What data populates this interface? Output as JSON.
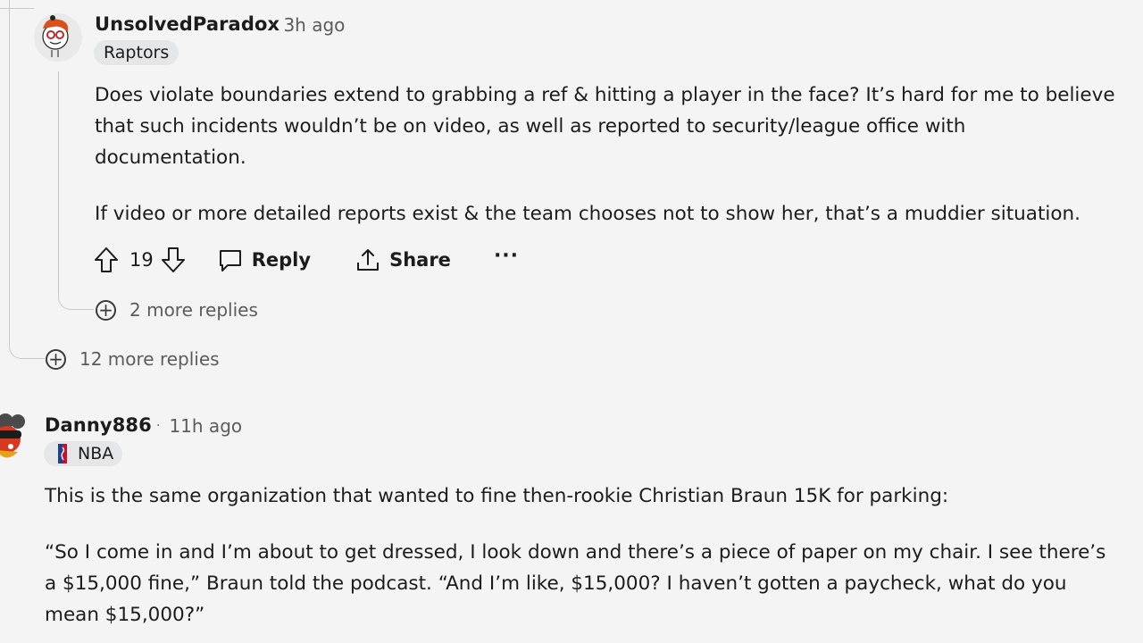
{
  "comment1": {
    "username": "UnsolvedParadox",
    "separator": "·",
    "time": "3h ago",
    "flair": "Raptors",
    "paragraphs": [
      "Does violate boundaries extend to grabbing a ref & hitting a player in the face? It’s hard for me to believe",
      "that such incidents wouldn’t be on video, as well as reported to security/league office with",
      "documentation.",
      "If video or more detailed reports exist & the team chooses not to show her, that’s a muddier situation."
    ],
    "votes": "19",
    "reply_label": "Reply",
    "share_label": "Share",
    "more_label": "···",
    "more_replies": "2 more replies"
  },
  "parent_more_replies": "12 more replies",
  "comment2": {
    "username": "Danny886",
    "separator": "·",
    "time": "11h ago",
    "flair": "NBA",
    "paragraphs": [
      "This is the same organization that wanted to fine then-rookie Christian Braun 15K for parking:",
      "“So I come in and I’m about to get dressed, I look down and there’s a piece of paper on my chair. I see there’s",
      "a $15,000 fine,” Braun told the podcast. “And I’m like, $15,000? I haven’t gotten a paycheck, what do you",
      "mean $15,000?”"
    ]
  },
  "icons": {
    "upvote": "upvote-arrow-icon",
    "downvote": "downvote-arrow-icon",
    "reply": "speech-bubble-icon",
    "share": "share-upload-icon",
    "expand": "plus-circle-icon"
  },
  "colors": {
    "background": "#f4f4f4",
    "text": "#1c1c1c",
    "muted": "#5c5c5c",
    "flair_bg": "#e4e6e7",
    "thread_line": "#c9c9c9"
  }
}
